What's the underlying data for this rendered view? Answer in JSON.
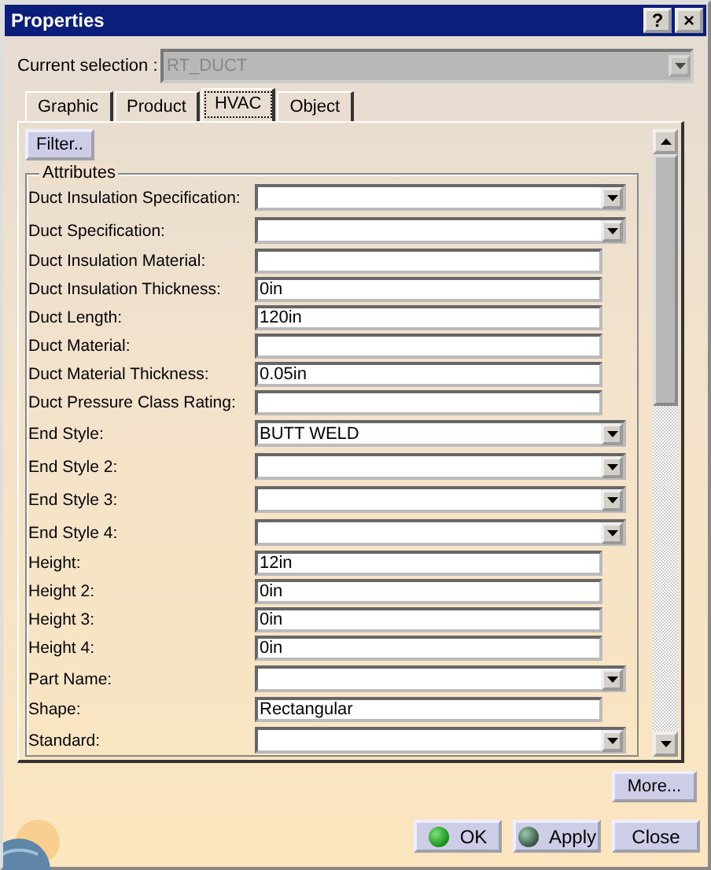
{
  "window": {
    "title": "Properties",
    "title_buttons": [
      "?",
      "×"
    ]
  },
  "current_selection": {
    "label": "Current selection :",
    "value": "RT_DUCT",
    "disabled": true
  },
  "tabs": [
    {
      "label": "Graphic",
      "selected": false
    },
    {
      "label": "Product",
      "selected": false
    },
    {
      "label": "HVAC",
      "selected": true
    },
    {
      "label": "Object",
      "selected": false
    }
  ],
  "filter_button": "Filter..",
  "attributes": {
    "title": "Attributes",
    "rows": [
      {
        "label": "Duct Insulation Specification:",
        "kind": "combo",
        "value": ""
      },
      {
        "label": "Duct Specification:",
        "kind": "combo",
        "value": ""
      },
      {
        "label": "Duct Insulation Material:",
        "kind": "text",
        "value": ""
      },
      {
        "label": "Duct Insulation Thickness:",
        "kind": "text",
        "value": "0in"
      },
      {
        "label": "Duct Length:",
        "kind": "text",
        "value": "120in"
      },
      {
        "label": "Duct Material:",
        "kind": "text",
        "value": ""
      },
      {
        "label": "Duct Material Thickness:",
        "kind": "text",
        "value": "0.05in"
      },
      {
        "label": "Duct Pressure Class Rating:",
        "kind": "text",
        "value": ""
      },
      {
        "label": "End Style:",
        "kind": "combo",
        "value": "BUTT WELD"
      },
      {
        "label": "End Style 2:",
        "kind": "combo",
        "value": ""
      },
      {
        "label": "End Style 3:",
        "kind": "combo",
        "value": ""
      },
      {
        "label": "End Style 4:",
        "kind": "combo",
        "value": ""
      },
      {
        "label": "Height:",
        "kind": "text",
        "value": "12in"
      },
      {
        "label": "Height 2:",
        "kind": "text",
        "value": "0in"
      },
      {
        "label": "Height 3:",
        "kind": "text",
        "value": "0in"
      },
      {
        "label": "Height 4:",
        "kind": "text",
        "value": "0in"
      },
      {
        "label": "Part Name:",
        "kind": "combo",
        "value": ""
      },
      {
        "label": "Shape:",
        "kind": "text",
        "value": "Rectangular"
      },
      {
        "label": "Standard:",
        "kind": "combo",
        "value": ""
      }
    ]
  },
  "more_button": "More...",
  "buttons": [
    {
      "label": "OK"
    },
    {
      "label": "Apply"
    },
    {
      "label": "Close"
    }
  ]
}
